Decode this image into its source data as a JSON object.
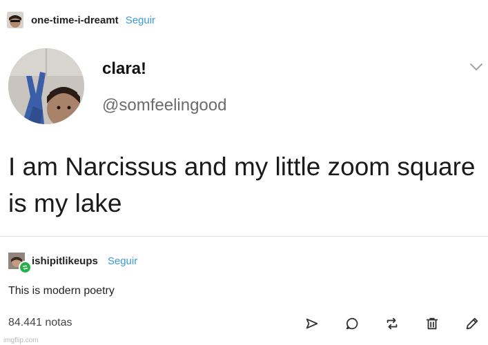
{
  "header": {
    "username": "one-time-i-dreamt",
    "follow_label": "Seguir"
  },
  "tweet": {
    "display_name": "clara!",
    "handle": "@somfeelingood",
    "text": "I am Narcissus and my little zoom square is my lake"
  },
  "reblog": {
    "username": "ishipitlikeups",
    "follow_label": "Seguir",
    "comment": "This is modern poetry"
  },
  "footer": {
    "notes": "84.441 notas",
    "actions": [
      "send-icon",
      "reply-icon",
      "reblog-icon",
      "delete-icon",
      "edit-icon"
    ]
  },
  "watermark": "imgflip.com",
  "colors": {
    "follow": "#3a9ad9",
    "reblog_badge": "#27b04a",
    "handle": "#6b6b6b"
  }
}
